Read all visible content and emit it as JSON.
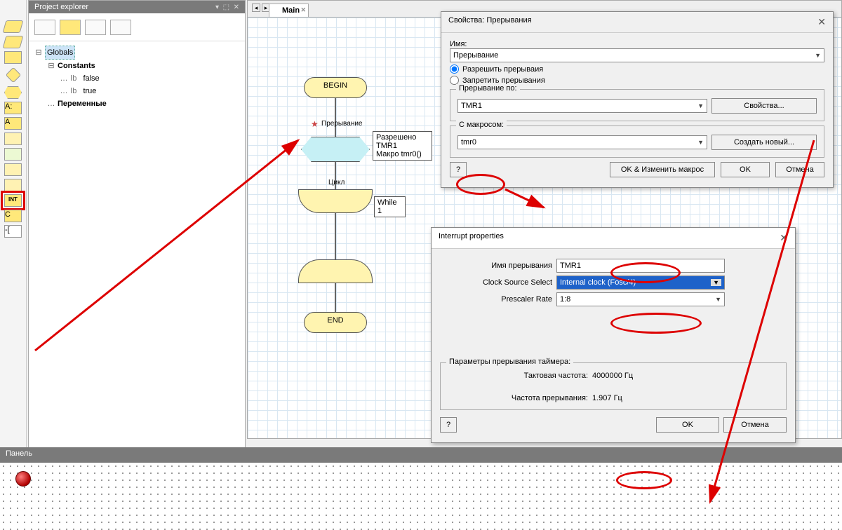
{
  "explorer": {
    "title": "Project explorer",
    "root": "Globals",
    "nodes": {
      "constants": "Constants",
      "false": "false",
      "true": "true",
      "vars": "Переменные"
    }
  },
  "toolbar_icons": [
    "I",
    "O",
    "D",
    "diamond",
    "hex",
    "A:",
    "A",
    "bulb",
    "rect1",
    "rect2",
    "rect3",
    "INT",
    "C",
    "code"
  ],
  "main": {
    "tab": "Main",
    "flow": {
      "begin": "BEGIN",
      "end": "END",
      "interrupt_title": "Прерывание",
      "interrupt_lines": [
        "Разрешено",
        "TMR1",
        "Макро tmr0()"
      ],
      "loop_title": "Цикл",
      "loop_lines": [
        "While",
        "1"
      ]
    }
  },
  "dlg1": {
    "title": "Свойства: Прерывания",
    "name_label": "Имя:",
    "name_value": "Прерывание",
    "opt_allow": "Разрешить прерываия",
    "opt_deny": "Запретить прерывания",
    "group_by": "Прерывание по:",
    "by_value": "TMR1",
    "btn_props": "Свойства...",
    "group_macro": "С макросом:",
    "macro_value": "tmr0",
    "btn_newmacro": "Создать новый...",
    "btn_help": "?",
    "btn_ok_edit": "OK & Изменить макрос",
    "btn_ok": "OK",
    "btn_cancel": "Отмена"
  },
  "dlg2": {
    "title": "Interrupt properties",
    "l_name": "Имя прерывания",
    "v_name": "TMR1",
    "l_clock": "Clock Source Select",
    "v_clock": "Internal clock (Fosc/4)",
    "l_presc": "Prescaler Rate",
    "v_presc": "1:8",
    "group_params": "Параметры прерывания таймера:",
    "l_freq": "Тактовая частота:",
    "v_freq": "4000000 Гц",
    "l_intfreq": "Частота прерывания:",
    "v_intfreq": "1.907 Гц",
    "btn_help": "?",
    "btn_ok": "OK",
    "btn_cancel": "Отмена"
  },
  "bottom": {
    "title": "Панель"
  }
}
